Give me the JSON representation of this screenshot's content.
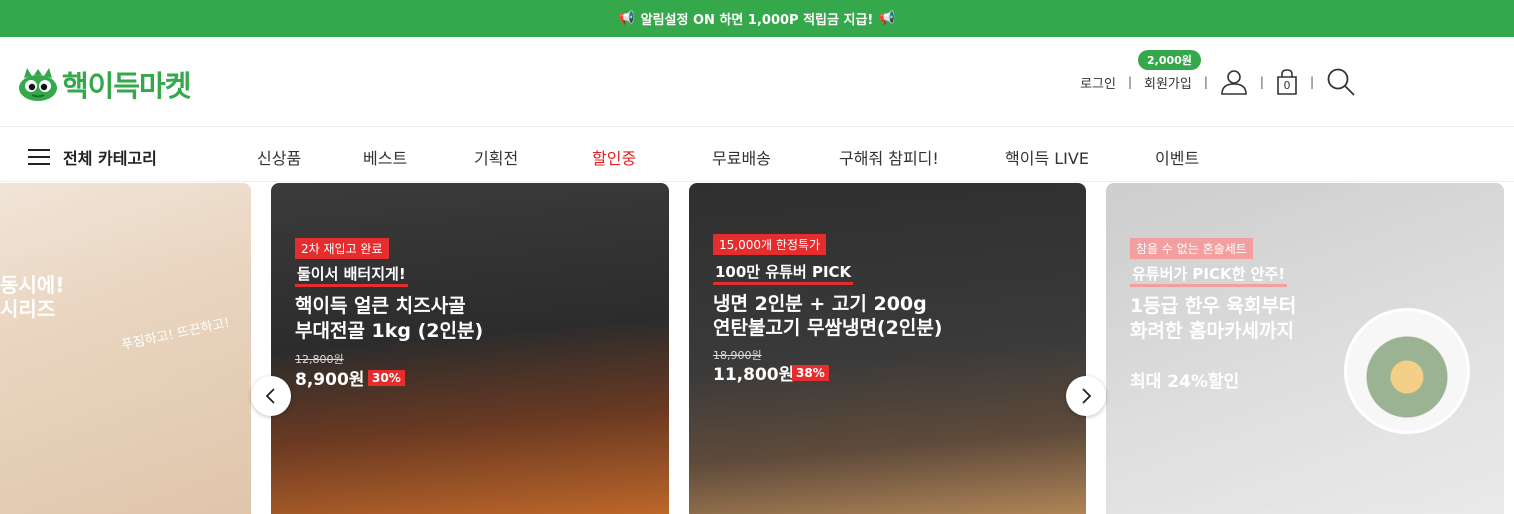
{
  "topbar": {
    "notice": "알림설정 ON 하면 1,000P 적립금 지급!"
  },
  "header": {
    "logo_text": "핵이득마켓",
    "login": "로그인",
    "join": "회원가입",
    "join_badge": "2,000원",
    "cart_count": "0"
  },
  "nav": {
    "all_categories": "전체 카테고리",
    "items": [
      "신상품",
      "베스트",
      "기획전",
      "할인중",
      "무료배송",
      "구해줘 참피디!",
      "핵이득 LIVE",
      "이벤트"
    ],
    "active_item": "할인중"
  },
  "banners": [
    {
      "lines": [
        "동시에!",
        "시리즈"
      ],
      "handwriting": "푸짐하고! 뜨끈하고!"
    },
    {
      "tag": "2차 재입고 완료",
      "sub": "둘이서 배터지게!",
      "title_1": "핵이득 얼큰 치즈사골",
      "title_2": "부대전골 1kg (2인분)",
      "old_price": "12,800원",
      "price": "8,900원",
      "discount": "30%"
    },
    {
      "tag": "15,000개 한정특가",
      "sub": "100만 유튜버 PICK",
      "title_1": "냉면 2인분 + 고기 200g",
      "title_2": "연탄불고기 무쌈냉면(2인분)",
      "old_price": "18,900원",
      "price": "11,800원",
      "discount": "38%"
    },
    {
      "tag": "참을 수 없는 혼술세트",
      "sub": "유튜버가 PICK한 안주!",
      "title_1": "1등급 한우 육회부터",
      "title_2": "화려한 홈마카세까지",
      "promo": "최대 24%할인"
    }
  ],
  "colors": {
    "brand_green": "#34a84a",
    "sale_red": "#e02020"
  }
}
